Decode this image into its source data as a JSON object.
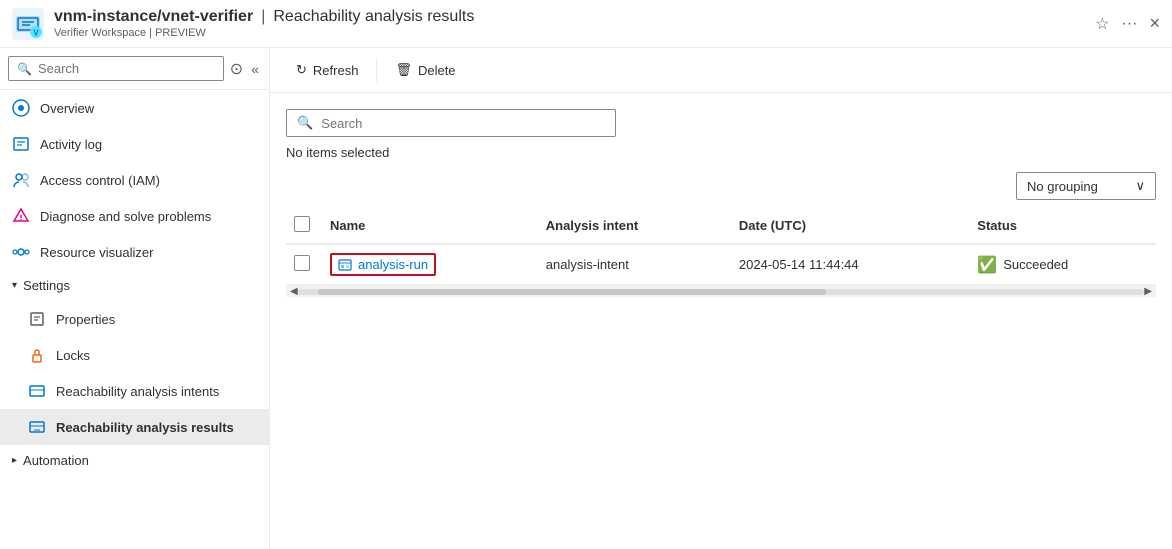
{
  "titleBar": {
    "resourcePath": "vnm-instance/vnet-verifier",
    "separator": "|",
    "pageTitle": "Reachability analysis results",
    "subtitle": "Verifier Workspace | PREVIEW",
    "closeLabel": "×"
  },
  "sidebar": {
    "searchPlaceholder": "Search",
    "navItems": [
      {
        "id": "overview",
        "label": "Overview",
        "icon": "overview"
      },
      {
        "id": "activity-log",
        "label": "Activity log",
        "icon": "activity"
      },
      {
        "id": "iam",
        "label": "Access control (IAM)",
        "icon": "iam"
      },
      {
        "id": "diagnose",
        "label": "Diagnose and solve problems",
        "icon": "diagnose"
      },
      {
        "id": "visualizer",
        "label": "Resource visualizer",
        "icon": "visualizer"
      }
    ],
    "settingsSection": {
      "label": "Settings",
      "items": [
        {
          "id": "properties",
          "label": "Properties",
          "icon": "properties"
        },
        {
          "id": "locks",
          "label": "Locks",
          "icon": "locks"
        },
        {
          "id": "reachability-intents",
          "label": "Reachability analysis intents",
          "icon": "reachability"
        },
        {
          "id": "reachability-results",
          "label": "Reachability analysis results",
          "icon": "reachability",
          "active": true
        }
      ]
    },
    "automationSection": {
      "label": "Automation"
    }
  },
  "toolbar": {
    "refreshLabel": "Refresh",
    "deleteLabel": "Delete"
  },
  "content": {
    "searchPlaceholder": "Search",
    "noItemsSelected": "No items selected",
    "groupingLabel": "No grouping",
    "table": {
      "columns": [
        "Name",
        "Analysis intent",
        "Date (UTC)",
        "Status"
      ],
      "rows": [
        {
          "name": "analysis-run",
          "analysisIntent": "analysis-intent",
          "dateUtc": "2024-05-14 11:44:44",
          "status": "Succeeded"
        }
      ]
    }
  }
}
